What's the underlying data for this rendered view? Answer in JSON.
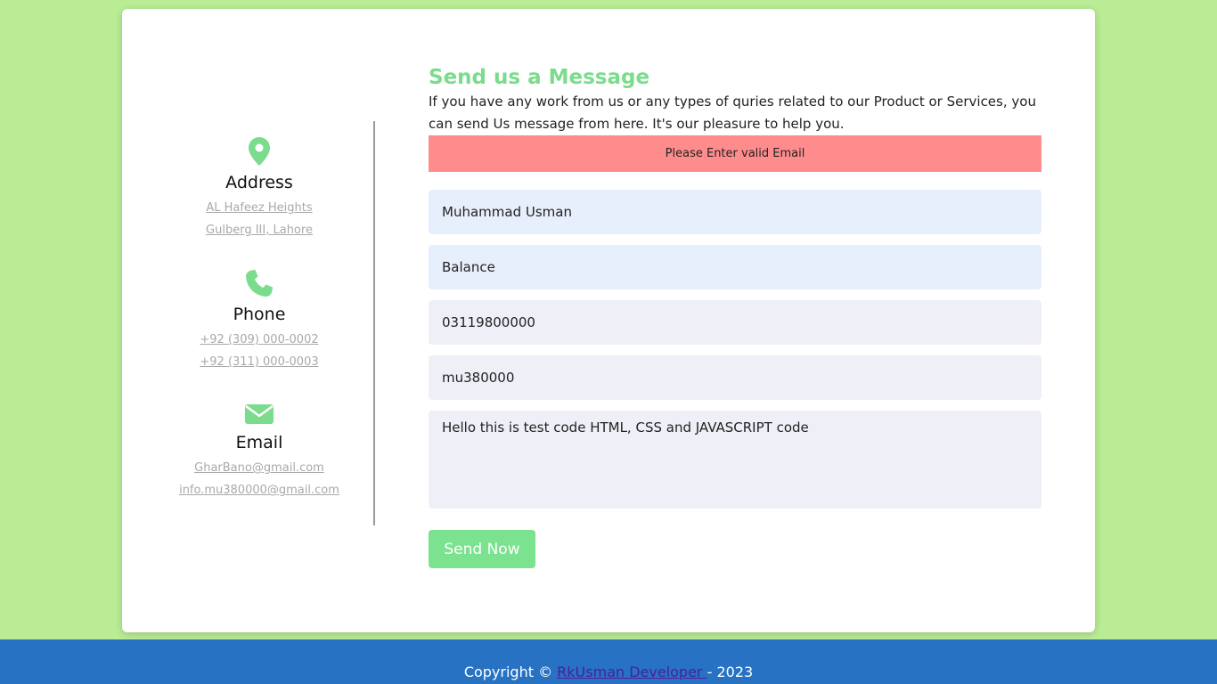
{
  "colors": {
    "page_bg": "#b9ec95",
    "accent": "#7bdc8d",
    "alert_bg": "#ff8c8c",
    "footer_bg": "#2772c3",
    "link_muted": "#a9a9a9"
  },
  "contact": {
    "address": {
      "icon": "map-pin-icon",
      "title": "Address",
      "lines": [
        "AL Hafeez Heights",
        "Gulberg III, Lahore"
      ]
    },
    "phone": {
      "icon": "phone-icon",
      "title": "Phone",
      "lines": [
        "+92 (309) 000-0002",
        "+92 (311) 000-0003"
      ]
    },
    "email": {
      "icon": "envelope-icon",
      "title": "Email",
      "lines": [
        "GharBano@gmail.com",
        "info.mu380000@gmail.com"
      ]
    }
  },
  "form": {
    "heading": "Send us a Message",
    "description": "If you have any work from us or any types of quries related to our Product or Services, you can send Us message from here. It's our pleasure to help you.",
    "alert": "Please Enter valid Email",
    "name_value": "Muhammad Usman",
    "subject_value": "Balance",
    "phone_value": "03119800000",
    "email_value": "mu380000",
    "message_value": "Hello this is test code HTML, CSS and JAVASCRIPT code",
    "send_label": "Send Now"
  },
  "footer": {
    "prefix": "Copyright © ",
    "link_text": "RkUsman Developer ",
    "suffix": " - 2023"
  }
}
